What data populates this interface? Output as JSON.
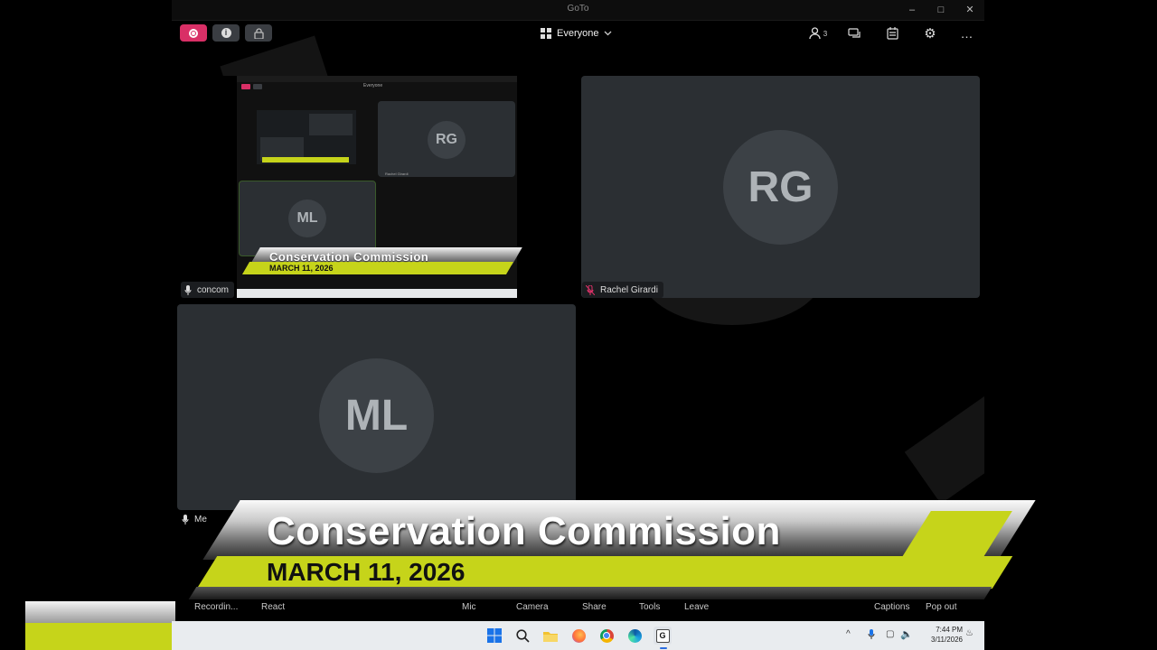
{
  "window": {
    "title": "GoTo"
  },
  "topbar": {
    "view_label": "Everyone",
    "participant_count": "3"
  },
  "thumbnail": {
    "title": "Conservation Commission",
    "date": "MARCH 11, 2026",
    "inner_view_label": "Everyone",
    "rg_initials": "RG",
    "ml_initials": "ML",
    "inner_rg_name": "Rachel Girardi"
  },
  "tiles": [
    {
      "name": "concom",
      "initials": ""
    },
    {
      "name": "Rachel Girardi",
      "initials": "RG"
    },
    {
      "name": "Me",
      "initials": "ML"
    }
  ],
  "banner": {
    "title": "Conservation Commission",
    "date": "MARCH 11, 2026"
  },
  "bottom_bar": {
    "recording": "Recordin...",
    "react": "React",
    "mic": "Mic",
    "camera": "Camera",
    "share": "Share",
    "tools": "Tools",
    "leave": "Leave",
    "captions": "Captions",
    "popout": "Pop out"
  },
  "taskbar": {
    "time": "7:44 PM",
    "date": "3/11/2026"
  },
  "colors": {
    "accent_yellow": "#c6d41a",
    "record_pink": "#e0336a",
    "tile_bg": "#2b2f33"
  },
  "icons": [
    "record-icon",
    "info-icon",
    "lock-icon",
    "grid-icon",
    "chevron-down-icon",
    "person-icon",
    "chat-icon",
    "notes-icon",
    "gear-icon",
    "more-icon",
    "mic-icon",
    "mic-muted-icon",
    "windows-start-icon",
    "search-icon",
    "folder-icon",
    "firefox-icon",
    "chrome-icon",
    "edge-icon",
    "goto-icon"
  ]
}
